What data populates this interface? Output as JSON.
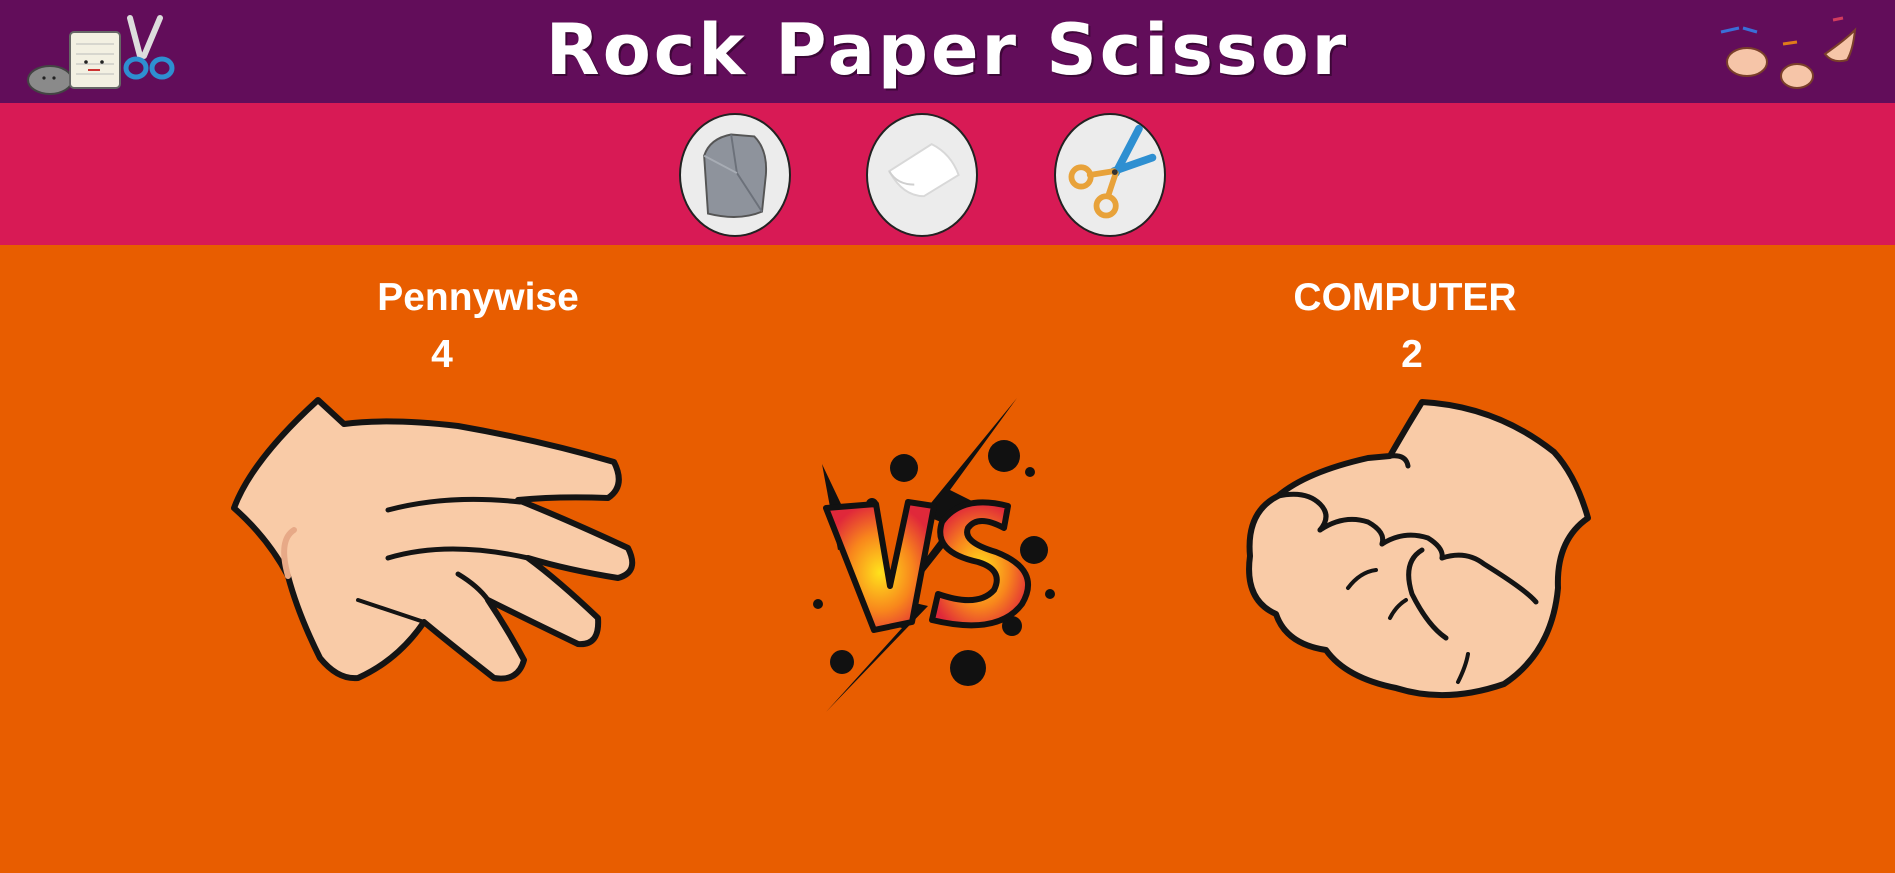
{
  "header": {
    "title": "Rock Paper Scissor",
    "logo_left_icon": "rock-paper-scissors-characters-logo",
    "logo_right_icon": "hand-gestures-logo",
    "background": "#620D5A"
  },
  "choices": {
    "background": "#D81A55",
    "items": [
      {
        "name": "rock",
        "icon": "rock-icon"
      },
      {
        "name": "paper",
        "icon": "paper-icon"
      },
      {
        "name": "scissors",
        "icon": "scissors-icon"
      }
    ]
  },
  "arena": {
    "background": "#E85D00",
    "player": {
      "name": "Pennywise",
      "score": "4",
      "hand": "paper-hand"
    },
    "computer": {
      "name": "COMPUTER",
      "score": "2",
      "hand": "rock-fist"
    },
    "vs_icon": "versus-burst-icon"
  }
}
